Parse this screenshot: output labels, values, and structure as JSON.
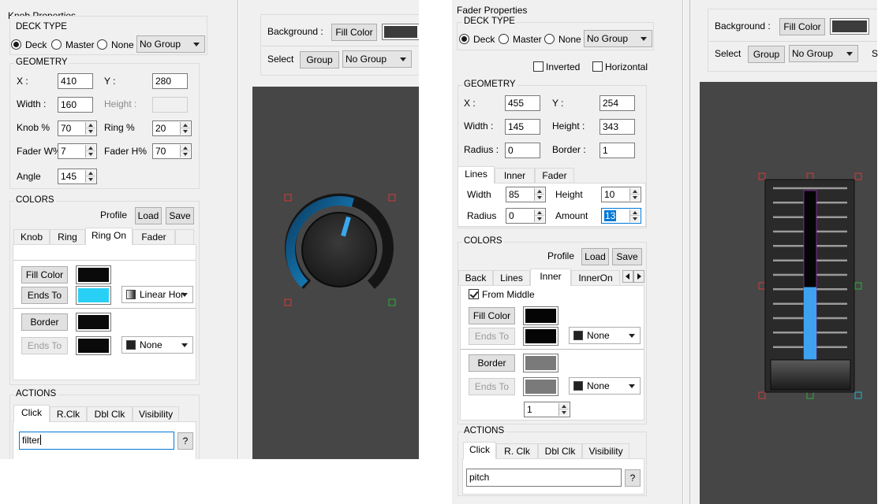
{
  "left": {
    "panel_title": "Knob Properties",
    "deck_type": {
      "title": "DECK TYPE",
      "options": [
        "Deck",
        "Master",
        "None"
      ],
      "selected": "Deck",
      "group": "No Group"
    },
    "geometry": {
      "title": "GEOMETRY",
      "x_label": "X :",
      "x": "410",
      "y_label": "Y :",
      "y": "280",
      "width_label": "Width :",
      "width": "160",
      "height_label": "Height :",
      "height": "",
      "knob_label": "Knob %",
      "knob": "70",
      "ring_label": "Ring %",
      "ring": "20",
      "faderw_label": "Fader W%",
      "faderw": "7",
      "faderh_label": "Fader H%",
      "faderh": "70",
      "angle_label": "Angle",
      "angle": "145"
    },
    "colors": {
      "title": "COLORS",
      "profile": "Profile",
      "load": "Load",
      "save": "Save",
      "tabs": [
        "Knob",
        "Ring",
        "Ring On",
        "Fader"
      ],
      "active_tab": "Ring On",
      "fill_color": "Fill Color",
      "fill_swatch": "#0a0a0a",
      "ends_to": "Ends To",
      "ends_swatch": "#29d0f5",
      "gradient": "Linear Hor",
      "border": "Border",
      "border_swatch": "#0a0a0a",
      "ends_to2": "Ends To",
      "ends2_swatch": "#0a0a0a",
      "gradient2": "None"
    },
    "actions": {
      "title": "ACTIONS",
      "tabs": [
        "Click",
        "R.Clk",
        "Dbl Clk",
        "Visibility"
      ],
      "active_tab": "Click",
      "value": "filter",
      "help": "?"
    }
  },
  "left_canvas": {
    "background_label": "Background :",
    "fill_color": "Fill Color",
    "bg_swatch": "#3c3c3c",
    "select_label": "Select",
    "group_btn": "Group",
    "group_value": "No Group",
    "knob": {
      "ring_color": "#1e9be0",
      "ring_fraction": 0.56,
      "indicator_color": "#3aa8ee"
    }
  },
  "right": {
    "panel_title": "Fader Properties",
    "deck_type": {
      "title": "DECK TYPE",
      "options": [
        "Deck",
        "Master",
        "None"
      ],
      "selected": "Deck",
      "group": "No Group"
    },
    "inverted": "Inverted",
    "horizontal": "Horizontal",
    "geometry": {
      "title": "GEOMETRY",
      "x_label": "X :",
      "x": "455",
      "y_label": "Y :",
      "y": "254",
      "width_label": "Width :",
      "width": "145",
      "height_label": "Height :",
      "height": "343",
      "radius_label": "Radius :",
      "radius": "0",
      "border_label": "Border :",
      "border": "1"
    },
    "lines": {
      "tabs": [
        "Lines",
        "Inner",
        "Fader"
      ],
      "active_tab": "Lines",
      "width_label": "Width",
      "width": "85",
      "height_label": "Height",
      "height": "10",
      "radius_label": "Radius",
      "radius": "0",
      "amount_label": "Amount",
      "amount": "13"
    },
    "colors": {
      "title": "COLORS",
      "profile": "Profile",
      "load": "Load",
      "save": "Save",
      "tabs": [
        "Back",
        "Lines",
        "Inner",
        "InnerOn"
      ],
      "active_tab": "Inner",
      "from_middle": "From Middle",
      "fill_color": "Fill Color",
      "fill_swatch": "#050505",
      "ends_to": "Ends To",
      "ends_swatch": "#050505",
      "gradient": "None",
      "border": "Border",
      "border_swatch": "#7a7a7a",
      "ends_to2": "Ends To",
      "ends2_swatch": "#7a7a7a",
      "gradient2": "None",
      "border_width": "1"
    },
    "actions": {
      "title": "ACTIONS",
      "tabs": [
        "Click",
        "R. Clk",
        "Dbl Clk",
        "Visibility"
      ],
      "active_tab": "Click",
      "value": "pitch",
      "help": "?"
    }
  },
  "right_canvas": {
    "background_label": "Background :",
    "fill_color": "Fill Color",
    "bg_swatch": "#3c3c3c",
    "select_label": "Select",
    "group_btn": "Group",
    "group_value": "No Group",
    "cut_label": "S",
    "fader": {
      "inner_color": "#3fa2f0",
      "value_fraction": 0.43,
      "line_count": 13
    }
  }
}
